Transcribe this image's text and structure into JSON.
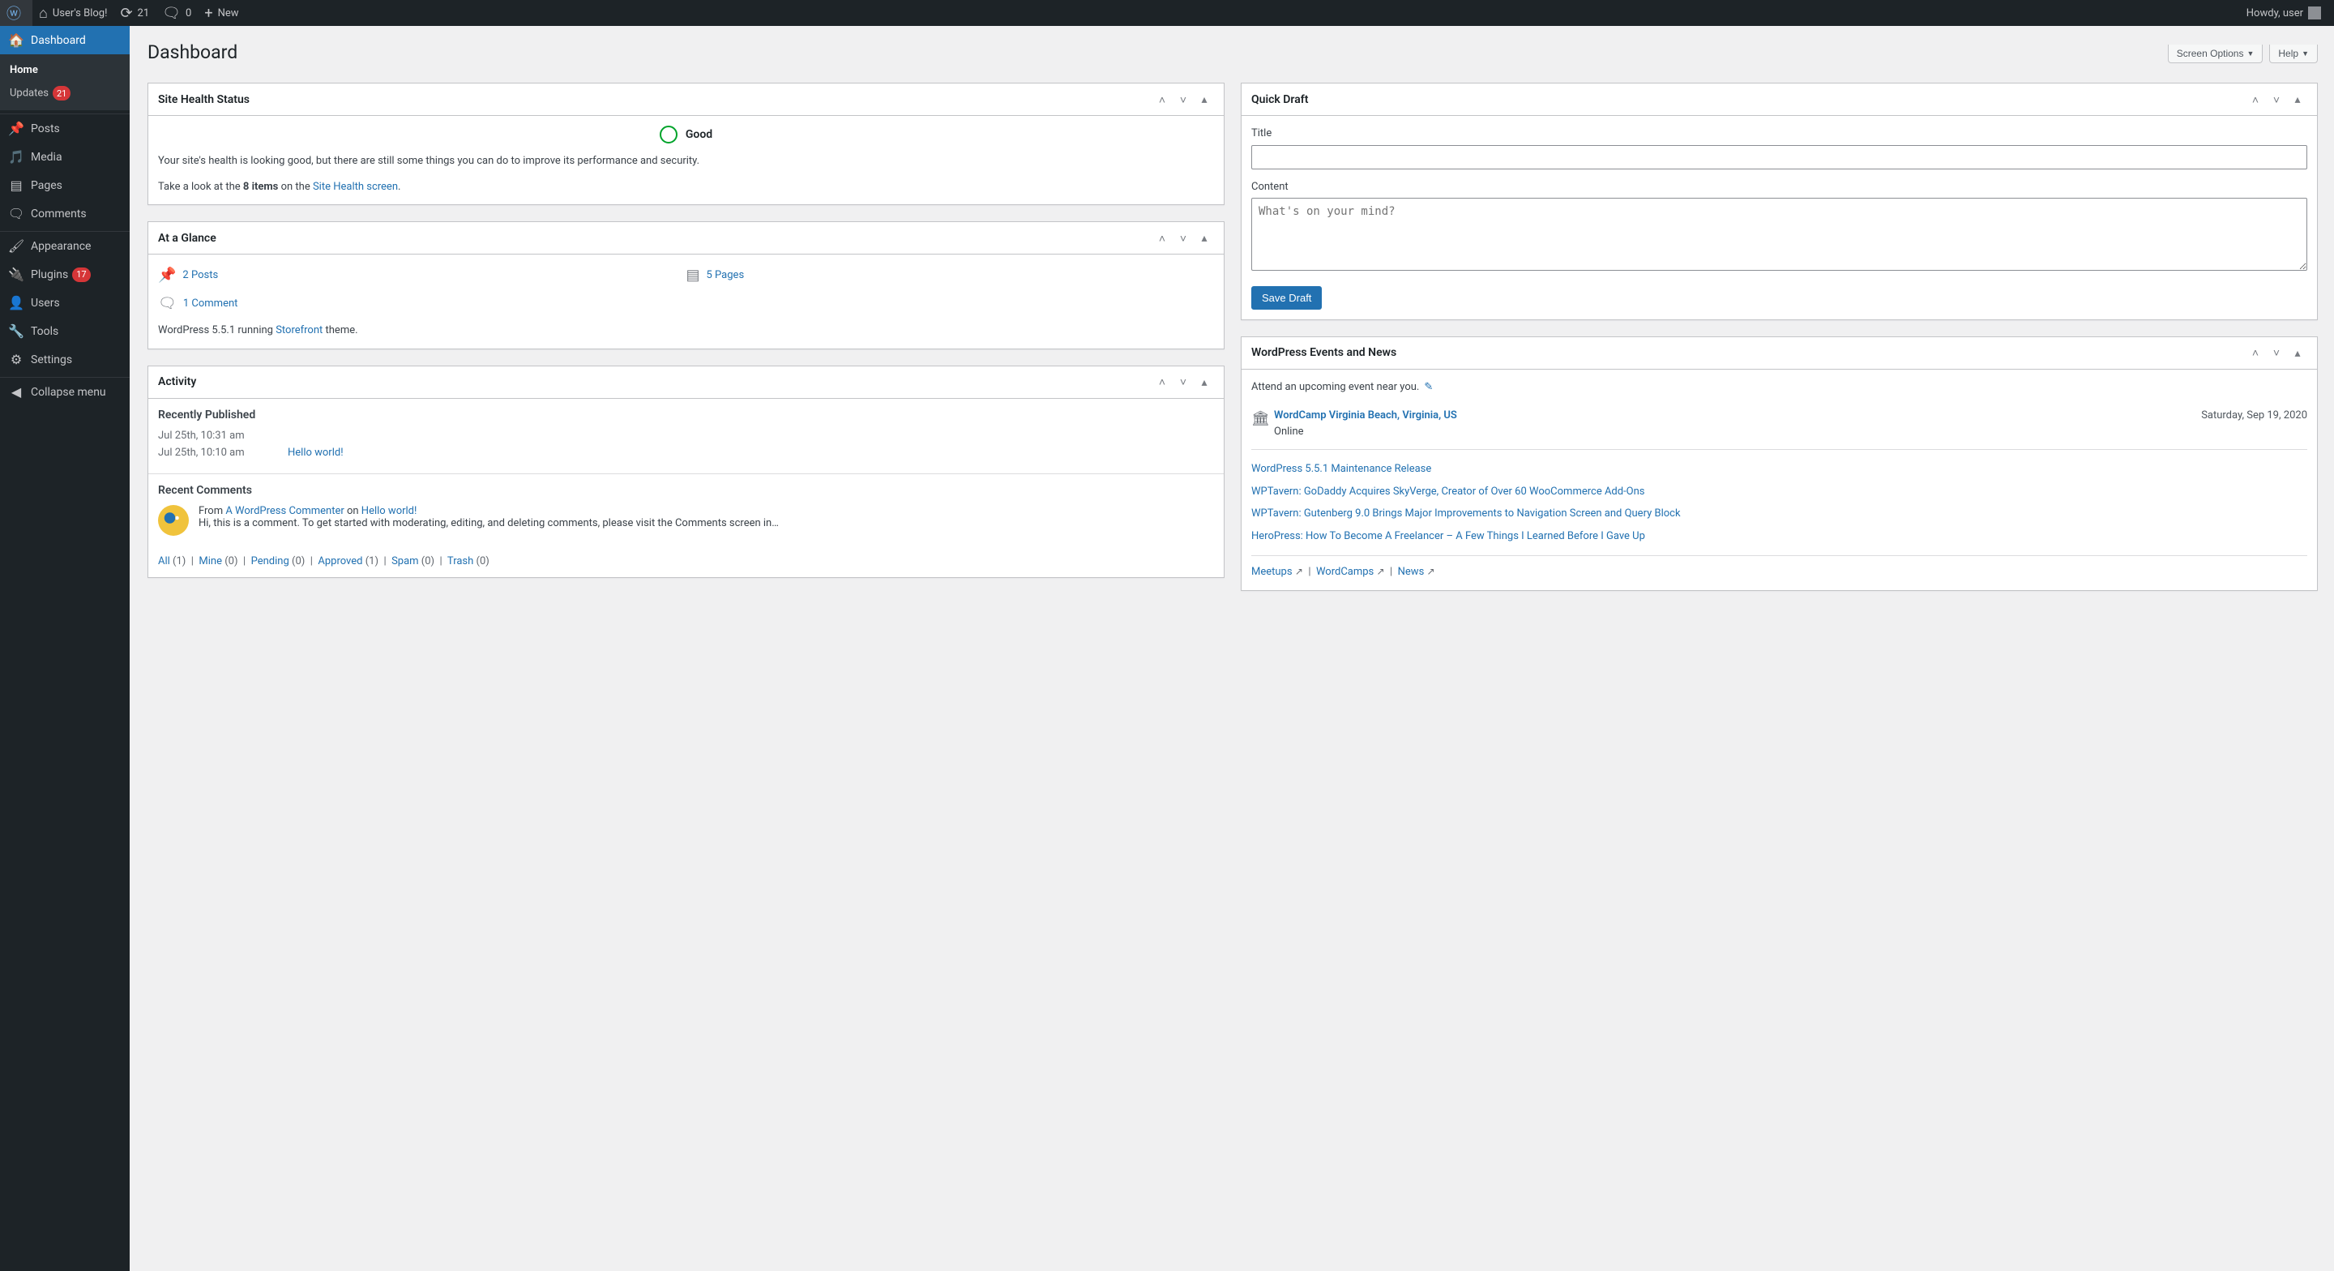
{
  "adminbar": {
    "site_name": "User's Blog!",
    "updates": "21",
    "comments": "0",
    "new": "New",
    "howdy": "Howdy, user"
  },
  "sidebar": {
    "dashboard": "Dashboard",
    "home": "Home",
    "updates": "Updates",
    "updates_count": "21",
    "posts": "Posts",
    "media": "Media",
    "pages": "Pages",
    "comments": "Comments",
    "appearance": "Appearance",
    "plugins": "Plugins",
    "plugins_count": "17",
    "users": "Users",
    "tools": "Tools",
    "settings": "Settings",
    "collapse": "Collapse menu"
  },
  "page": {
    "title": "Dashboard",
    "screen_options": "Screen Options",
    "help": "Help"
  },
  "health": {
    "title": "Site Health Status",
    "status": "Good",
    "p1": "Your site's health is looking good, but there are still some things you can do to improve its performance and security.",
    "p2a": "Take a look at the ",
    "p2b": "8 items",
    "p2c": " on the ",
    "p2link": "Site Health screen",
    "p2d": "."
  },
  "glance": {
    "title": "At a Glance",
    "posts": "2 Posts",
    "pages": "5 Pages",
    "comments": "1 Comment",
    "version_a": "WordPress 5.5.1 running ",
    "theme": "Storefront",
    "version_b": " theme."
  },
  "activity": {
    "title": "Activity",
    "recent": "Recently Published",
    "rows": [
      {
        "date": "Jul 25th, 10:31 am",
        "title": ""
      },
      {
        "date": "Jul 25th, 10:10 am",
        "title": "Hello world!"
      }
    ],
    "recent_comments": "Recent Comments",
    "from": "From ",
    "commenter": "A WordPress Commenter",
    "on": " on ",
    "post": "Hello world!",
    "comment_text": "Hi, this is a comment. To get started with moderating, editing, and deleting comments, please visit the Comments screen in…",
    "filters": {
      "all": "All",
      "all_c": " (1)",
      "mine": "Mine",
      "mine_c": " (0)",
      "pending": "Pending",
      "pending_c": " (0)",
      "approved": "Approved",
      "approved_c": " (1)",
      "spam": "Spam",
      "spam_c": " (0)",
      "trash": "Trash",
      "trash_c": " (0)"
    }
  },
  "quickdraft": {
    "title": "Quick Draft",
    "label_title": "Title",
    "label_content": "Content",
    "placeholder": "What's on your mind?",
    "save": "Save Draft"
  },
  "events": {
    "title": "WordPress Events and News",
    "near": "Attend an upcoming event near you.",
    "event_title": "WordCamp Virginia Beach, Virginia, US",
    "event_loc": "Online",
    "event_date": "Saturday, Sep 19, 2020",
    "news": [
      "WordPress 5.5.1 Maintenance Release",
      "WPTavern: GoDaddy Acquires SkyVerge, Creator of Over 60 WooCommerce Add-Ons",
      "WPTavern: Gutenberg 9.0 Brings Major Improvements to Navigation Screen and Query Block",
      "HeroPress: How To Become A Freelancer – A Few Things I Learned Before I Gave Up"
    ],
    "foot": {
      "meetups": "Meetups",
      "wordcamps": "WordCamps",
      "news": "News"
    }
  }
}
